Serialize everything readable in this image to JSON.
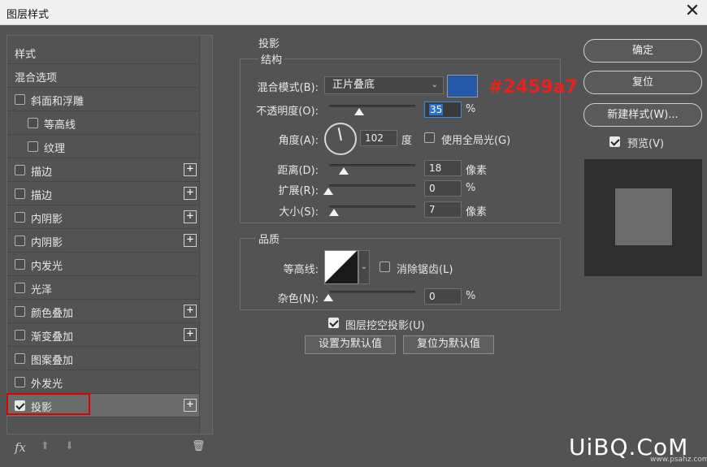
{
  "window": {
    "title": "图层样式",
    "close_glyph": "✕"
  },
  "left_panel": {
    "items": [
      {
        "label": "样式",
        "checkbox": false,
        "checked": false,
        "plus": false,
        "indent": 0
      },
      {
        "label": "混合选项",
        "checkbox": false,
        "checked": false,
        "plus": false,
        "indent": 0
      },
      {
        "label": "斜面和浮雕",
        "checkbox": true,
        "checked": false,
        "plus": false,
        "indent": 0
      },
      {
        "label": "等高线",
        "checkbox": true,
        "checked": false,
        "plus": false,
        "indent": 1
      },
      {
        "label": "纹理",
        "checkbox": true,
        "checked": false,
        "plus": false,
        "indent": 1
      },
      {
        "label": "描边",
        "checkbox": true,
        "checked": false,
        "plus": true,
        "indent": 0
      },
      {
        "label": "描边",
        "checkbox": true,
        "checked": false,
        "plus": true,
        "indent": 0
      },
      {
        "label": "内阴影",
        "checkbox": true,
        "checked": false,
        "plus": true,
        "indent": 0
      },
      {
        "label": "内阴影",
        "checkbox": true,
        "checked": false,
        "plus": true,
        "indent": 0
      },
      {
        "label": "内发光",
        "checkbox": true,
        "checked": false,
        "plus": false,
        "indent": 0
      },
      {
        "label": "光泽",
        "checkbox": true,
        "checked": false,
        "plus": false,
        "indent": 0
      },
      {
        "label": "颜色叠加",
        "checkbox": true,
        "checked": false,
        "plus": true,
        "indent": 0
      },
      {
        "label": "渐变叠加",
        "checkbox": true,
        "checked": false,
        "plus": true,
        "indent": 0
      },
      {
        "label": "图案叠加",
        "checkbox": true,
        "checked": false,
        "plus": false,
        "indent": 0
      },
      {
        "label": "外发光",
        "checkbox": true,
        "checked": false,
        "plus": false,
        "indent": 0
      },
      {
        "label": "投影",
        "checkbox": true,
        "checked": true,
        "plus": true,
        "indent": 0,
        "selected": true
      }
    ],
    "plus_glyph": "+",
    "tools": {
      "fx": "fx",
      "up": "⬆",
      "down": "⬇",
      "trash": "🗑"
    }
  },
  "drop_shadow": {
    "section_title": "投影",
    "structure": {
      "title": "结构",
      "blend_mode_label": "混合模式(B):",
      "blend_mode_value": "正片叠底",
      "color": "#2459a7",
      "color_annotation": "#2459a7",
      "opacity_label": "不透明度(O):",
      "opacity_value": "35",
      "opacity_fraction": 0.35,
      "opacity_unit": "%",
      "angle_label": "角度(A):",
      "angle_value": "102",
      "angle_unit": "度",
      "global_light_label": "使用全局光(G)",
      "global_light_checked": false,
      "distance_label": "距离(D):",
      "distance_value": "18",
      "distance_unit": "像素",
      "spread_label": "扩展(R):",
      "spread_value": "0",
      "spread_unit": "%",
      "size_label": "大小(S):",
      "size_value": "7",
      "size_unit": "像素"
    },
    "quality": {
      "title": "品质",
      "contour_label": "等高线:",
      "antialias_label": "消除锯齿(L)",
      "antialias_checked": false,
      "noise_label": "杂色(N):",
      "noise_value": "0",
      "noise_unit": "%"
    },
    "knockout_label": "图层挖空投影(U)",
    "knockout_checked": true,
    "make_default": "设置为默认值",
    "reset_default": "复位为默认值"
  },
  "right_panel": {
    "ok": "确定",
    "reset": "复位",
    "new_style": "新建样式(W)...",
    "preview_label": "预览(V)",
    "preview_checked": true
  },
  "watermark": {
    "main": "UiBQ.CoM",
    "sub": "www.psahz.com"
  }
}
